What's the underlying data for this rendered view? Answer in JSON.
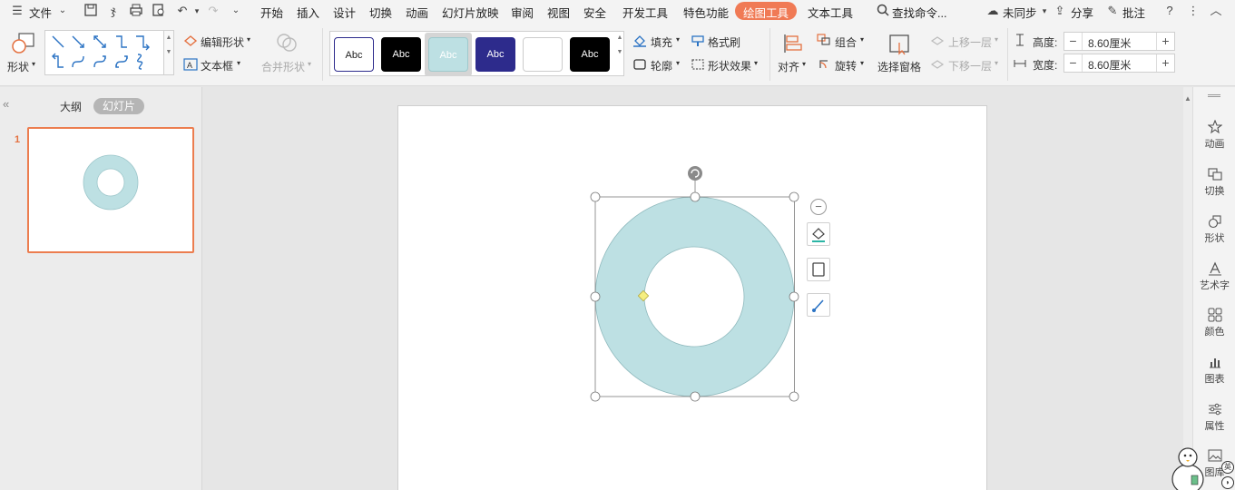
{
  "menubar": {
    "file": "文件",
    "tabs": [
      "开始",
      "插入",
      "设计",
      "切换",
      "动画",
      "幻灯片放映",
      "审阅",
      "视图",
      "安全",
      "开发工具",
      "特色功能"
    ],
    "active_tab": "绘图工具",
    "text_tool": "文本工具",
    "search": "查找命令...",
    "sync": "未同步",
    "share": "分享",
    "comment": "批注"
  },
  "ribbon": {
    "shape": "形状",
    "edit_shape": "编辑形状",
    "text_box": "文本框",
    "merge_shape": "合并形状",
    "style_sample": "Abc",
    "fill": "填充",
    "format_painter": "格式刷",
    "outline": "轮廓",
    "shape_effect": "形状效果",
    "align": "对齐",
    "group": "组合",
    "rotate": "旋转",
    "selection_pane": "选择窗格",
    "bring_forward": "上移一层",
    "send_backward": "下移一层",
    "height_label": "高度:",
    "height_value": "8.60厘米",
    "width_label": "宽度:",
    "width_value": "8.60厘米"
  },
  "left_panel": {
    "outline_tab": "大纲",
    "slides_tab": "幻灯片",
    "slide_number": "1"
  },
  "right_sidebar": [
    {
      "label": "动画",
      "icon": "animation-icon"
    },
    {
      "label": "切换",
      "icon": "transition-icon"
    },
    {
      "label": "形状",
      "icon": "shape-icon"
    },
    {
      "label": "艺术字",
      "icon": "wordart-icon"
    },
    {
      "label": "颜色",
      "icon": "color-icon"
    },
    {
      "label": "图表",
      "icon": "chart-icon"
    },
    {
      "label": "属性",
      "icon": "properties-icon"
    },
    {
      "label": "图库",
      "icon": "gallery-icon"
    }
  ],
  "colors": {
    "donut_fill": "#bde0e3",
    "accent_tab": "#f07a55",
    "thumb_border": "#ec7d4f"
  }
}
